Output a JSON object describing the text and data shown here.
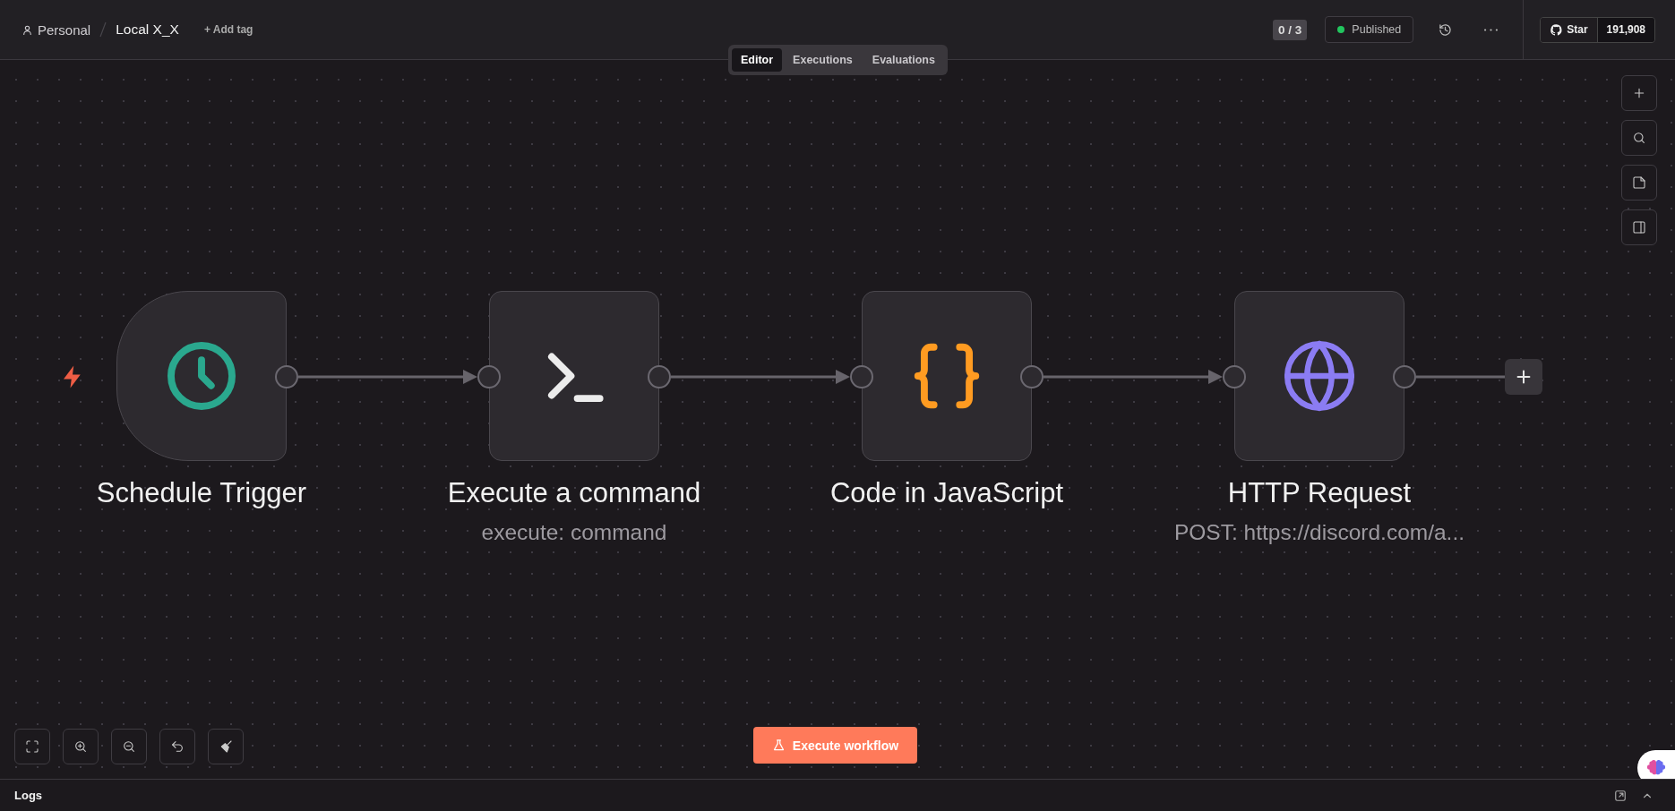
{
  "breadcrumb": {
    "project": "Personal",
    "workflow": "Local X_X",
    "add_tag": "+ Add tag"
  },
  "tabs": [
    {
      "label": "Editor",
      "selected": true
    },
    {
      "label": "Executions",
      "selected": false
    },
    {
      "label": "Evaluations",
      "selected": false
    }
  ],
  "header": {
    "counter": "0 / 3",
    "status": {
      "label": "Published",
      "published": true
    },
    "github": {
      "label": "Star",
      "count": "191,908"
    }
  },
  "nodes": [
    {
      "kind": "trigger",
      "title": "Schedule Trigger"
    },
    {
      "kind": "command",
      "title": "Execute a command",
      "subtitle": "execute: command"
    },
    {
      "kind": "code",
      "title": "Code in JavaScript"
    },
    {
      "kind": "http",
      "title": "HTTP Request",
      "subtitle": "POST: https://discord.com/a..."
    }
  ],
  "execute_button": "Execute workflow",
  "logs": {
    "title": "Logs"
  }
}
